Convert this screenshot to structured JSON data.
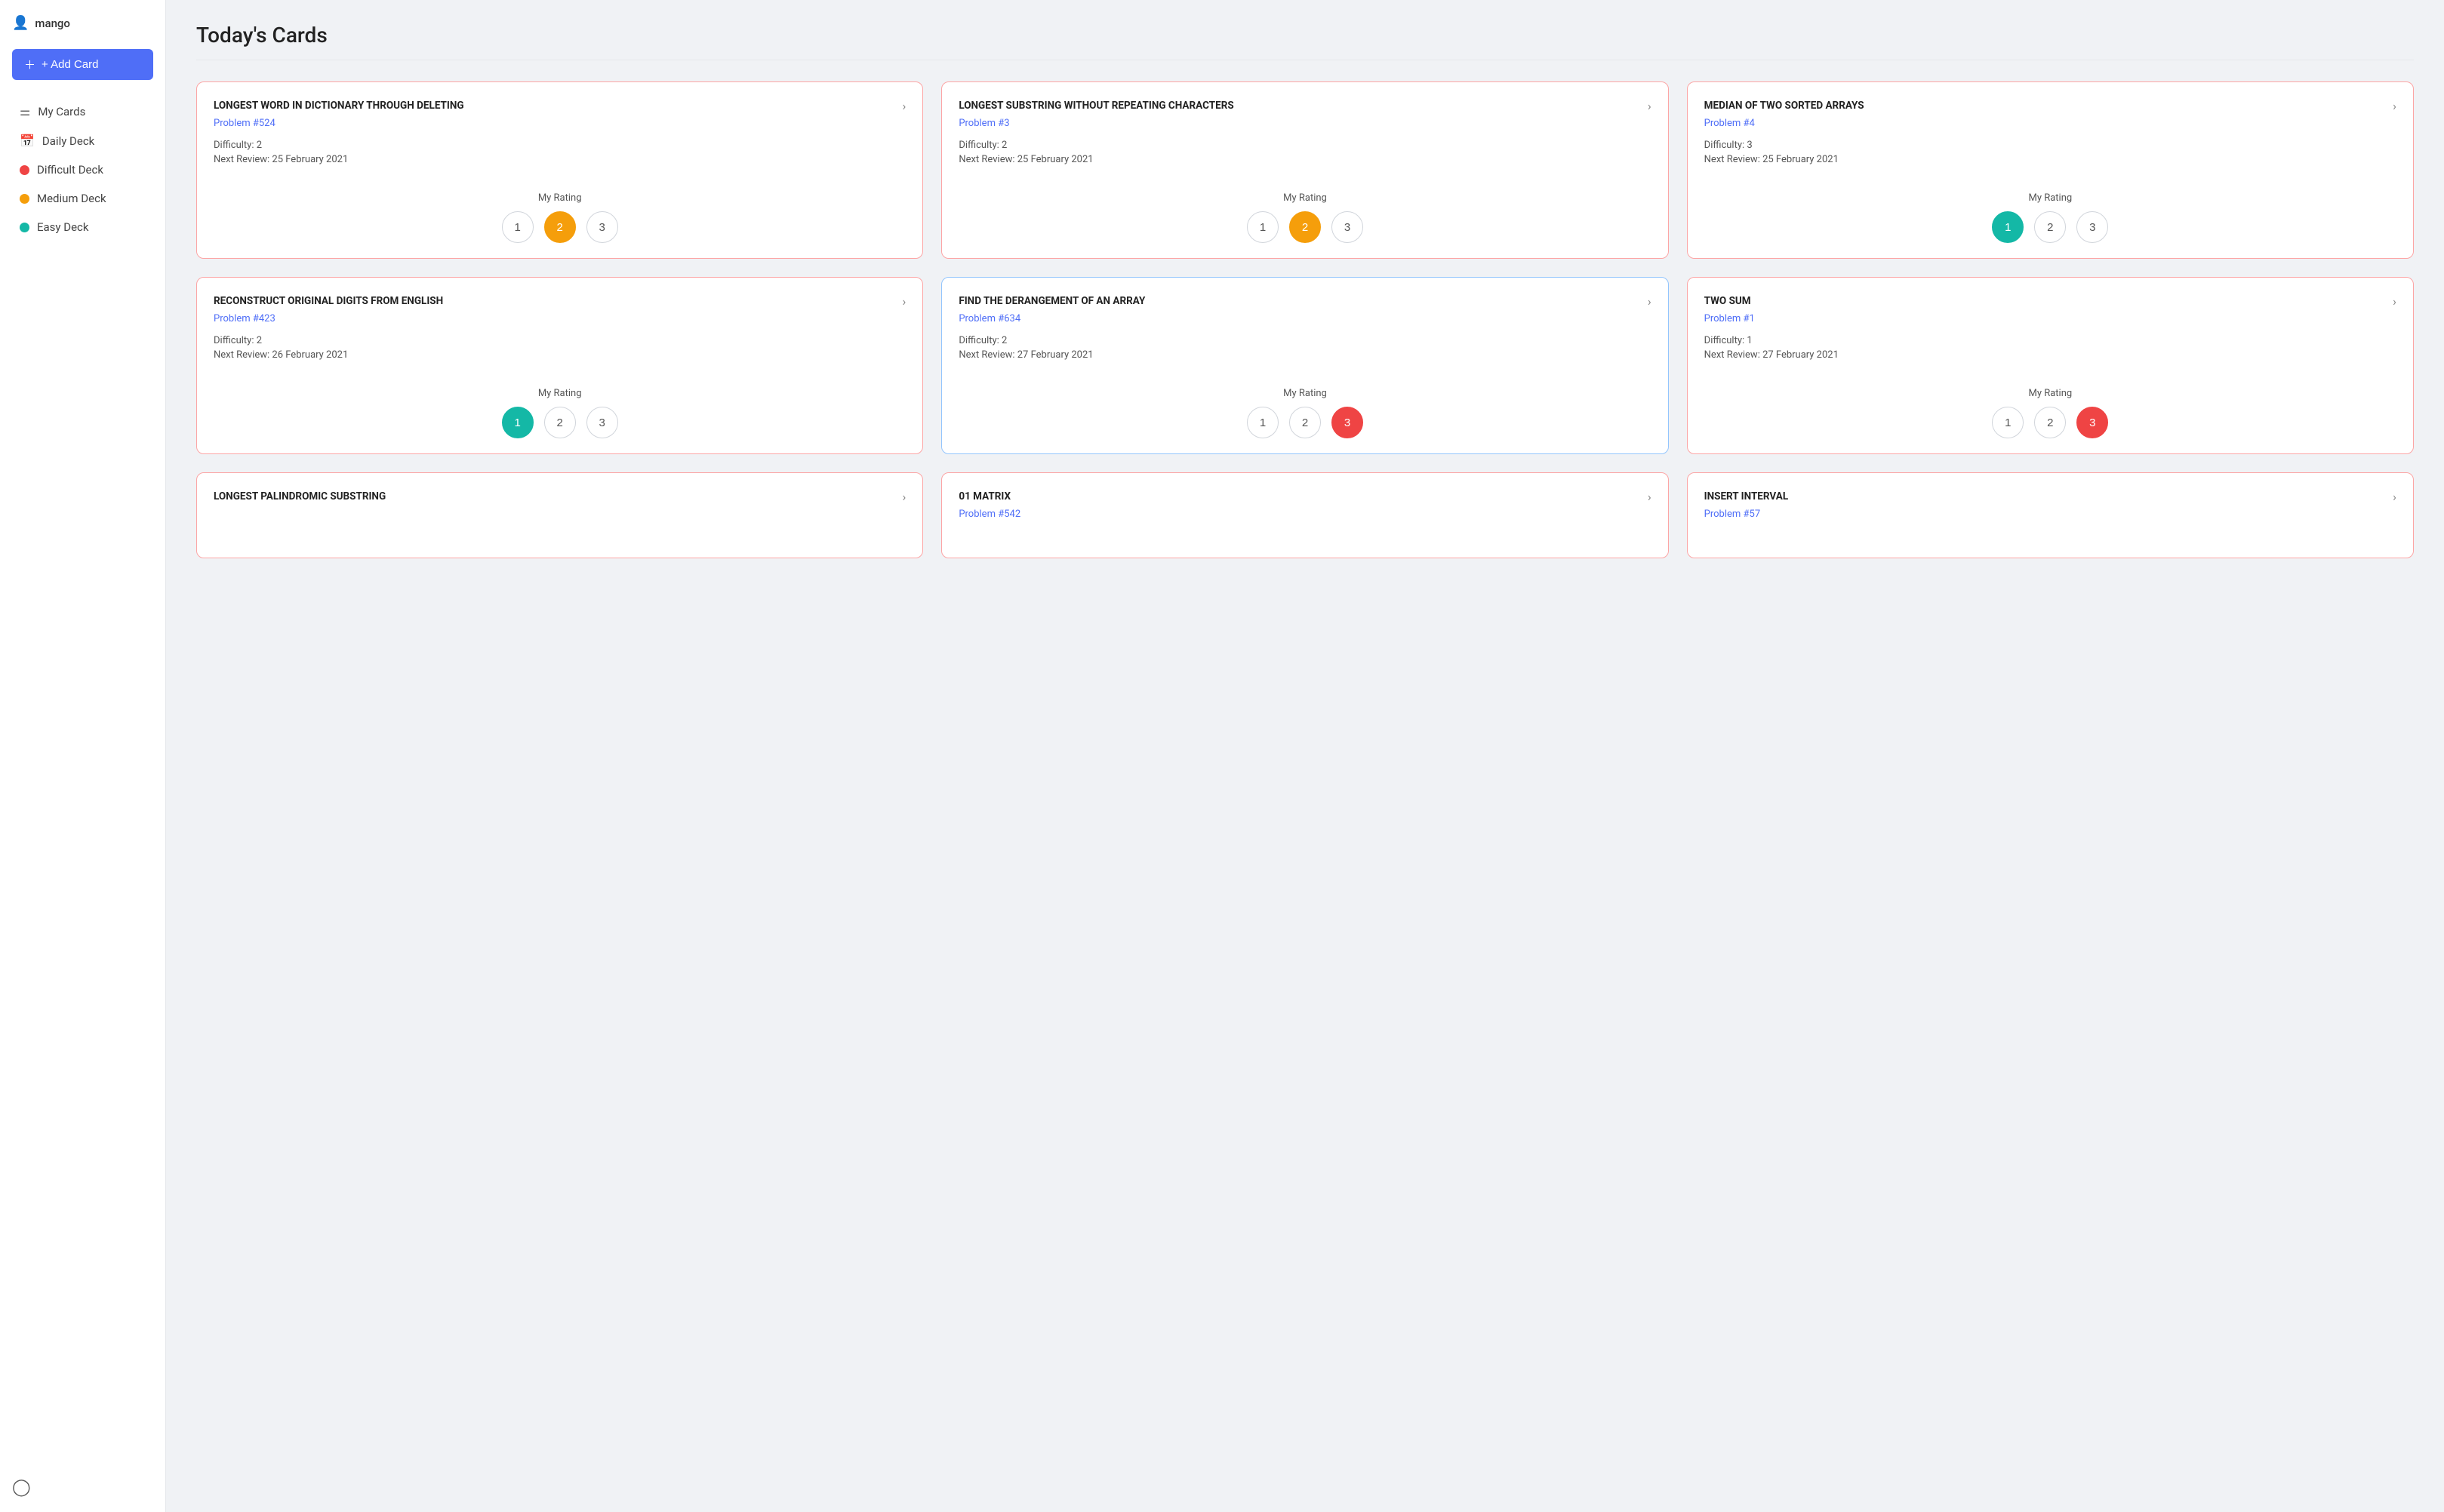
{
  "sidebar": {
    "user": "mango",
    "add_card_label": "+ Add Card",
    "nav": [
      {
        "id": "my-cards",
        "label": "My Cards",
        "icon": "layers"
      },
      {
        "id": "daily-deck",
        "label": "Daily Deck",
        "icon": "calendar"
      }
    ],
    "decks": [
      {
        "id": "difficult",
        "label": "Difficult Deck",
        "color": "red"
      },
      {
        "id": "medium",
        "label": "Medium Deck",
        "color": "yellow"
      },
      {
        "id": "easy",
        "label": "Easy Deck",
        "color": "teal"
      }
    ]
  },
  "page": {
    "title": "Today's Cards"
  },
  "cards": [
    {
      "id": 1,
      "title": "LONGEST WORD IN DICTIONARY THROUGH DELETING",
      "problem": "Problem #524",
      "difficulty": "Difficulty: 2",
      "next_review": "Next Review: 25 February 2021",
      "rating_label": "My Rating",
      "active_rating": 2,
      "active_class": "active-yellow",
      "border": "pink"
    },
    {
      "id": 2,
      "title": "LONGEST SUBSTRING WITHOUT REPEATING CHARACTERS",
      "problem": "Problem #3",
      "difficulty": "Difficulty: 2",
      "next_review": "Next Review: 25 February 2021",
      "rating_label": "My Rating",
      "active_rating": 2,
      "active_class": "active-yellow",
      "border": "pink"
    },
    {
      "id": 3,
      "title": "MEDIAN OF TWO SORTED ARRAYS",
      "problem": "Problem #4",
      "difficulty": "Difficulty: 3",
      "next_review": "Next Review: 25 February 2021",
      "rating_label": "My Rating",
      "active_rating": 1,
      "active_class": "active-teal",
      "border": "pink"
    },
    {
      "id": 4,
      "title": "RECONSTRUCT ORIGINAL DIGITS FROM ENGLISH",
      "problem": "Problem #423",
      "difficulty": "Difficulty: 2",
      "next_review": "Next Review: 26 February 2021",
      "rating_label": "My Rating",
      "active_rating": 1,
      "active_class": "active-teal",
      "border": "pink"
    },
    {
      "id": 5,
      "title": "FIND THE DERANGEMENT OF AN ARRAY",
      "problem": "Problem #634",
      "difficulty": "Difficulty: 2",
      "next_review": "Next Review: 27 February 2021",
      "rating_label": "My Rating",
      "active_rating": 3,
      "active_class": "active-red",
      "border": "blue"
    },
    {
      "id": 6,
      "title": "TWO SUM",
      "problem": "Problem #1",
      "difficulty": "Difficulty: 1",
      "next_review": "Next Review: 27 February 2021",
      "rating_label": "My Rating",
      "active_rating": 3,
      "active_class": "active-red",
      "border": "pink"
    },
    {
      "id": 7,
      "title": "LONGEST PALINDROMIC SUBSTRING",
      "problem": "",
      "difficulty": "",
      "next_review": "",
      "rating_label": "",
      "active_rating": 0,
      "active_class": "",
      "border": "pink"
    },
    {
      "id": 8,
      "title": "01 MATRIX",
      "problem": "Problem #542",
      "difficulty": "",
      "next_review": "",
      "rating_label": "",
      "active_rating": 0,
      "active_class": "",
      "border": "pink"
    },
    {
      "id": 9,
      "title": "INSERT INTERVAL",
      "problem": "Problem #57",
      "difficulty": "",
      "next_review": "",
      "rating_label": "",
      "active_rating": 0,
      "active_class": "",
      "border": "pink"
    }
  ]
}
